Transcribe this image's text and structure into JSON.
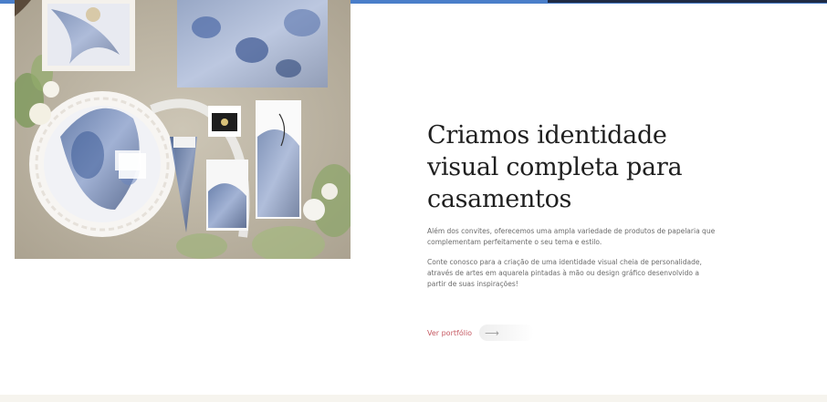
{
  "section": {
    "heading_line1": "Criamos identidade",
    "heading_line2": "visual completa para",
    "heading_line3": "casamentos",
    "paragraph1": "Além dos convites, oferecemos uma ampla variedade de produtos de papelaria que complementam perfeitamente o seu tema e estilo.",
    "paragraph2": "Conte conosco para a criação de uma identidade visual cheia de personalidade, através de artes em aquarela pintadas à mão ou design gráfico desenvolvido a partir de suas inspirações!",
    "portfolio_label": "Ver portfólio"
  },
  "colors": {
    "accent_link": "#c65a63",
    "top_border": "#4a7ec9",
    "bottom_band": "#f6f4ee"
  },
  "icons": {
    "portfolio_arrow": "arrow-right-icon"
  }
}
